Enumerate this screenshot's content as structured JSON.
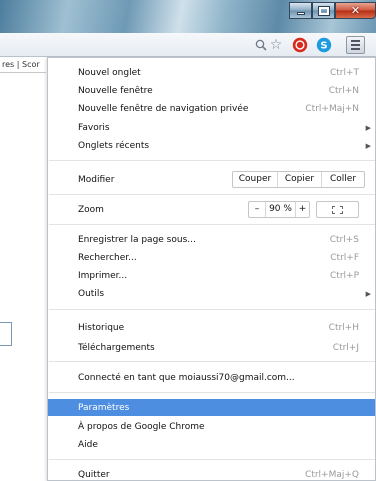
{
  "window": {
    "controls": {
      "minimize": "minimize-icon",
      "maximize": "maximize-icon",
      "close": "✕"
    }
  },
  "toolbar": {
    "icons": [
      "zoom-icon",
      "star-icon",
      "stop-extension-icon",
      "skype-extension-icon",
      "hamburger-menu-icon"
    ],
    "extension_colors": {
      "stop": "#d9281c",
      "skype": "#1c9be0"
    }
  },
  "page": {
    "tab_fragment": "res | Scor"
  },
  "menu": {
    "new_tab": {
      "label": "Nouvel onglet",
      "shortcut": "Ctrl+T"
    },
    "new_window": {
      "label": "Nouvelle fenêtre",
      "shortcut": "Ctrl+N"
    },
    "incognito": {
      "label": "Nouvelle fenêtre de navigation privée",
      "shortcut": "Ctrl+Maj+N"
    },
    "bookmarks": {
      "label": "Favoris"
    },
    "recent_tabs": {
      "label": "Onglets récents"
    },
    "edit": {
      "label": "Modifier",
      "cut": "Couper",
      "copy": "Copier",
      "paste": "Coller"
    },
    "zoom": {
      "label": "Zoom",
      "minus": "–",
      "value": "90 %",
      "plus": "+"
    },
    "save_page": {
      "label": "Enregistrer la page sous...",
      "shortcut": "Ctrl+S"
    },
    "find": {
      "label": "Rechercher...",
      "shortcut": "Ctrl+F"
    },
    "print": {
      "label": "Imprimer...",
      "shortcut": "Ctrl+P"
    },
    "tools": {
      "label": "Outils"
    },
    "history": {
      "label": "Historique",
      "shortcut": "Ctrl+H"
    },
    "downloads": {
      "label": "Téléchargements",
      "shortcut": "Ctrl+J"
    },
    "signed_in": {
      "label": "Connecté en tant que moiaussi70@gmail.com..."
    },
    "settings": {
      "label": "Paramètres",
      "highlighted": true
    },
    "about": {
      "label": "À propos de Google Chrome"
    },
    "help": {
      "label": "Aide"
    },
    "quit": {
      "label": "Quitter",
      "shortcut": "Ctrl+Maj+Q"
    },
    "highlight_color": "#4d8ee0"
  }
}
